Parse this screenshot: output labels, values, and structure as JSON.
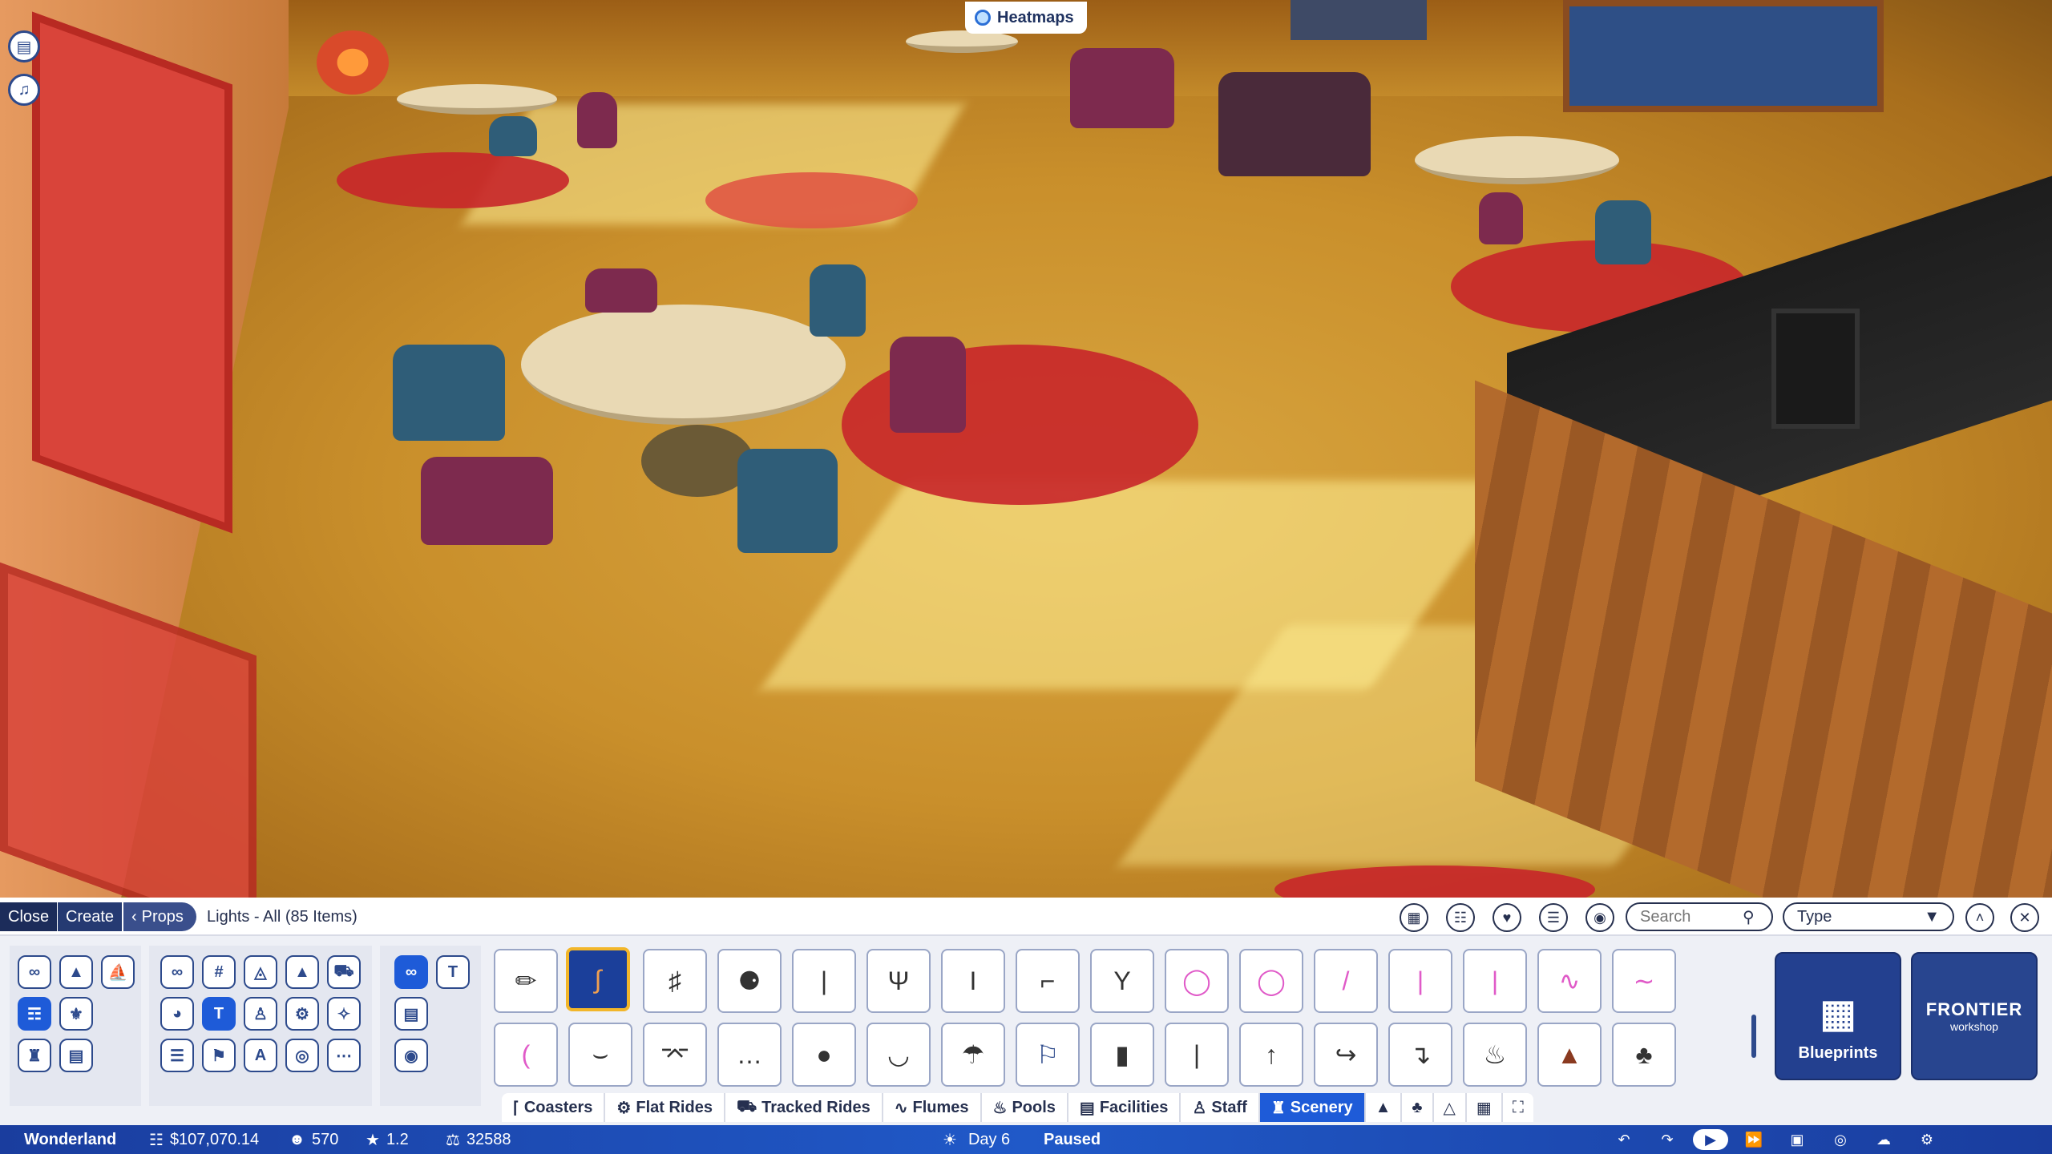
{
  "heatmaps": {
    "label": "Heatmaps"
  },
  "side_buttons": [
    {
      "icon": "clipboard-icon"
    },
    {
      "icon": "bell-icon"
    }
  ],
  "breadcrumb": {
    "close": "Close",
    "create": "Create",
    "props": "Props"
  },
  "list_title": "Lights - All (85 Items)",
  "toolbar_icons": [
    "blueprint-save-icon",
    "group-icon",
    "heart-icon",
    "filter-icon",
    "eye-toggle-icon"
  ],
  "search": {
    "placeholder": "Search",
    "value": ""
  },
  "type_select": {
    "value": "Type"
  },
  "category_icons": {
    "group1": [
      "infinity-icon",
      "tree-icon",
      "boat-icon",
      "pole-icon",
      "fountain-icon",
      "tower-icon",
      "sign-icon"
    ],
    "group2": [
      "infinity-icon",
      "grid-icon",
      "frame-icon",
      "build-icon",
      "vehicle-icon",
      "dome-icon",
      "lamp-icon",
      "person-icon",
      "gear-icon",
      "sprinkler-icon",
      "stack-icon",
      "banner-icon",
      "letter-a-icon",
      "ring-icon",
      "more-icon"
    ],
    "group3": [
      "infinity-icon",
      "lamp-post-icon",
      "billboard-icon",
      "light-icon"
    ]
  },
  "items_row1": [
    "torch-light",
    "curved-lamp",
    "lantern-post",
    "tiki-torch",
    "candle-stick",
    "branch-light",
    "pole-light",
    "hook-light",
    "tulip-light",
    "neon-ring",
    "neon-ring-2",
    "neon-tube-diag",
    "neon-tube",
    "neon-tube-2",
    "neon-wave",
    "neon-wave-2"
  ],
  "items_row2": [
    "neon-arc",
    "string-lights",
    "string-lights-2",
    "string-lights-3",
    "hanging-bulb",
    "bowl-light",
    "umbrella-light",
    "spot-post",
    "pillar-light",
    "pole-plain",
    "hanging-lamp",
    "arm-lamp",
    "bracket-lamp",
    "chandelier",
    "brazier",
    "post-lantern"
  ],
  "cards": {
    "blueprints": "Blueprints",
    "frontier_line1": "FRONTIER",
    "frontier_line2": "workshop"
  },
  "tabs": [
    "Coasters",
    "Flat Rides",
    "Tracked Rides",
    "Flumes",
    "Pools",
    "Facilities",
    "Staff",
    "Scenery"
  ],
  "tab_icons": [
    "terrain-icon",
    "trees-icon",
    "mountain-icon",
    "path-icon",
    "expand-icon"
  ],
  "status": {
    "park": "Wonderland",
    "money": "$107,070.14",
    "guests": "570",
    "rating": "1.2",
    "research": "32588",
    "day": "Day 6",
    "state": "Paused"
  },
  "colors": {
    "accent": "#1e5bd8",
    "navy": "#1c2c5a",
    "selected_border": "#f2b62a"
  }
}
